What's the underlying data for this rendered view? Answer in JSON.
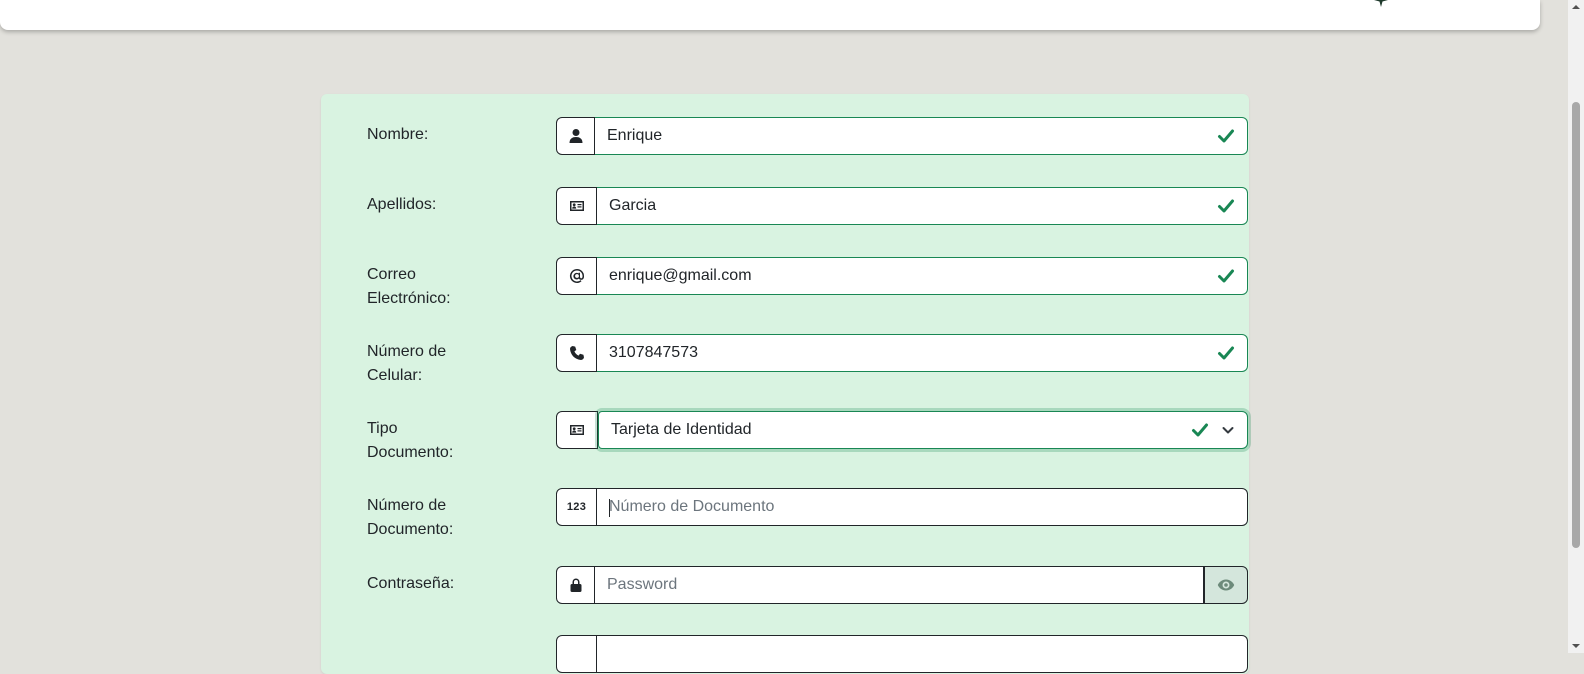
{
  "form": {
    "nombre": {
      "label": "Nombre:",
      "value": "Enrique",
      "icon": "user-icon",
      "valid": true
    },
    "apellidos": {
      "label": "Apellidos:",
      "value": "Garcia",
      "icon": "id-card-icon",
      "valid": true
    },
    "correo": {
      "label": "Correo Electrónico:",
      "value": "enrique@gmail.com",
      "icon": "at-icon",
      "valid": true
    },
    "celular": {
      "label": "Número de Celular:",
      "value": "3107847573",
      "icon": "phone-icon",
      "valid": true
    },
    "tipo_documento": {
      "label": "Tipo Documento:",
      "value": "Tarjeta de Identidad",
      "icon": "id-badge-icon",
      "valid": true
    },
    "numero_documento": {
      "label": "Número de Documento:",
      "placeholder": "Número de Documento",
      "addon_text": "123"
    },
    "contrasena": {
      "label": "Contraseña:",
      "placeholder": "Password",
      "icon": "lock-icon",
      "toggle_icon": "eye-icon"
    }
  },
  "colors": {
    "valid": "#198754",
    "card_bg": "#d9f3e1",
    "page_bg": "#e2e1dc"
  }
}
